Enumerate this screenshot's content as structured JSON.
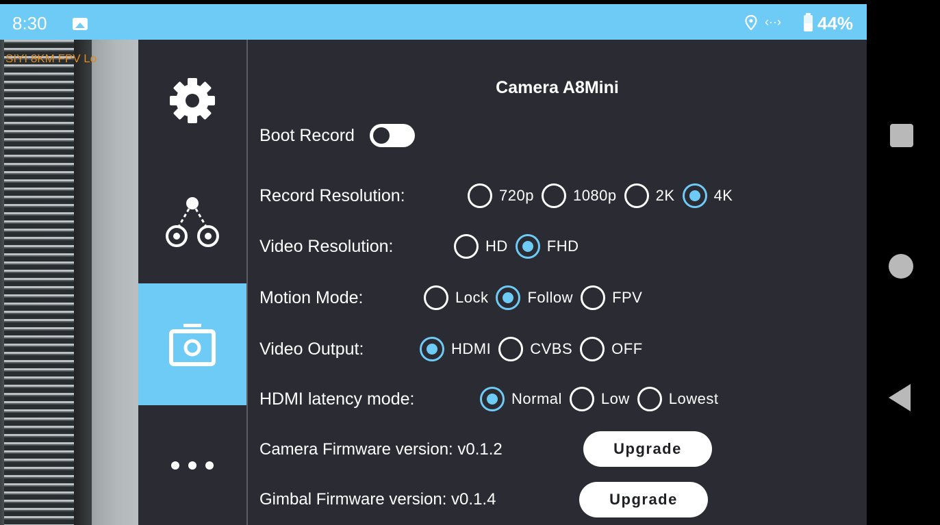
{
  "status_bar": {
    "time": "8:30",
    "battery_percent": "44%",
    "battery_level": 0.44,
    "icons": [
      "image-icon",
      "location-icon",
      "data-sync-icon",
      "battery-icon"
    ]
  },
  "feed": {
    "overlay_label": "SIYI  8KM FPV Lo"
  },
  "side_menu": {
    "items": [
      {
        "name": "settings",
        "icon": "gear-icon",
        "active": false
      },
      {
        "name": "gimbal",
        "icon": "gimbal-icon",
        "active": false
      },
      {
        "name": "camera",
        "icon": "camera-icon",
        "active": true
      },
      {
        "name": "more",
        "icon": "more-dots-icon",
        "active": false
      }
    ]
  },
  "panel": {
    "title": "Camera A8Mini",
    "boot_record": {
      "label": "Boot Record",
      "enabled": false
    },
    "record_resolution": {
      "label": "Record Resolution:",
      "options": [
        "720p",
        "1080p",
        "2K",
        "4K"
      ],
      "selected": "4K"
    },
    "video_resolution": {
      "label": "Video Resolution:",
      "options": [
        "HD",
        "FHD"
      ],
      "selected": "FHD"
    },
    "motion_mode": {
      "label": "Motion Mode:",
      "options": [
        "Lock",
        "Follow",
        "FPV"
      ],
      "selected": "Follow"
    },
    "video_output": {
      "label": "Video Output:",
      "options": [
        "HDMI",
        "CVBS",
        "OFF"
      ],
      "selected": "HDMI"
    },
    "hdmi_latency": {
      "label": "HDMI latency mode:",
      "options": [
        "Normal",
        "Low",
        "Lowest"
      ],
      "selected": "Normal"
    },
    "camera_firmware": {
      "label": "Camera Firmware version: v0.1.2",
      "button": "Upgrade"
    },
    "gimbal_firmware": {
      "label": "Gimbal Firmware version: v0.1.4",
      "button": "Upgrade"
    }
  },
  "colors": {
    "accent": "#6ecbf5",
    "panel_bg": "#2b2c33",
    "status_bar": "#6ecbf5"
  }
}
